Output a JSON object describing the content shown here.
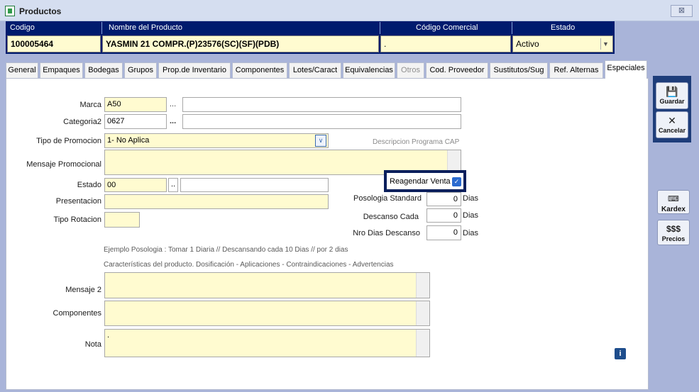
{
  "window": {
    "title": "Productos",
    "close_glyph": "⊠"
  },
  "header": {
    "columns": [
      "Codigo",
      "Nombre del Producto",
      "Código Comercial",
      "Estado"
    ],
    "codigo": "100005464",
    "nombre": "YASMIN 21 COMPR.(P)23576(SC)(SF)(PDB)",
    "codigo_comercial": ".",
    "estado": "Activo"
  },
  "tabs": [
    "General",
    "Empaques",
    "Bodegas",
    "Grupos",
    "Prop.de Inventario",
    "Componentes",
    "Lotes/Caract",
    "Equivalencias",
    "Otros",
    "Cod. Proveedor",
    "Sustitutos/Sug",
    "Ref. Alternas",
    "Especiales"
  ],
  "form": {
    "marca_label": "Marca",
    "marca_value": "A50",
    "categoria_label": "Categoria2",
    "categoria_value": "0627",
    "tipo_promocion_label": "Tipo de Promocion",
    "tipo_promocion_value": "1- No Aplica",
    "descripcion_cap_label": "Descripcion Programa CAP",
    "mensaje_promocional_label": "Mensaje Promocional",
    "estado_label": "Estado",
    "estado_value": "00",
    "reagendar_label": "Reagendar Venta",
    "presentacion_label": "Presentacion",
    "tipo_rotacion_label": "Tipo Rotacion",
    "posologia_label": "Posologia Standard",
    "posologia_value": "0",
    "descanso_label": "Descanso Cada",
    "descanso_value": "0",
    "nro_dias_label": "Nro Dias Descanso",
    "nro_dias_value": "0",
    "dias_unit": "Dias",
    "ejemplo_text": "Ejemplo Posologia : Tomar 1 Diaria // Descansando cada 10 Dias // por 2 dias",
    "caracteristicas_text": "Características del producto. Dosificación - Aplicaciones - Contraindicaciones - Advertencias",
    "mensaje2_label": "Mensaje 2",
    "componentes_label": "Componentes",
    "nota_label": "Nota",
    "nota_value": ".",
    "ellipsis": "...",
    "ellipsis_short": ".."
  },
  "toolbar": {
    "guardar": "Guardar",
    "cancelar": "Cancelar",
    "kardex": "Kardex",
    "precios_symbol": "$$$",
    "precios": "Precios"
  },
  "icons": {
    "save": "floppy-icon",
    "cancel": "x-icon",
    "kardex": "keyboard-icon",
    "info": "info-icon"
  },
  "colors": {
    "header_bg": "#001b6e",
    "field_bg": "#fffbd0",
    "highlight_border": "#0a1f5c"
  }
}
